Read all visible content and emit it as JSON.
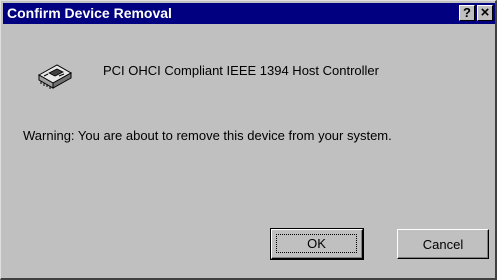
{
  "window": {
    "title": "Confirm Device Removal",
    "help_button": "?",
    "close_button": "×"
  },
  "device": {
    "icon": "pci-card-icon",
    "name": "PCI OHCI Compliant IEEE 1394 Host Controller"
  },
  "message": {
    "warning": "Warning: You are about to remove this device from your system."
  },
  "buttons": {
    "ok_label": "OK",
    "cancel_label": "Cancel"
  },
  "colors": {
    "titlebar": "#000080",
    "dialog_face": "#c0c0c0",
    "title_text": "#ffffff"
  }
}
